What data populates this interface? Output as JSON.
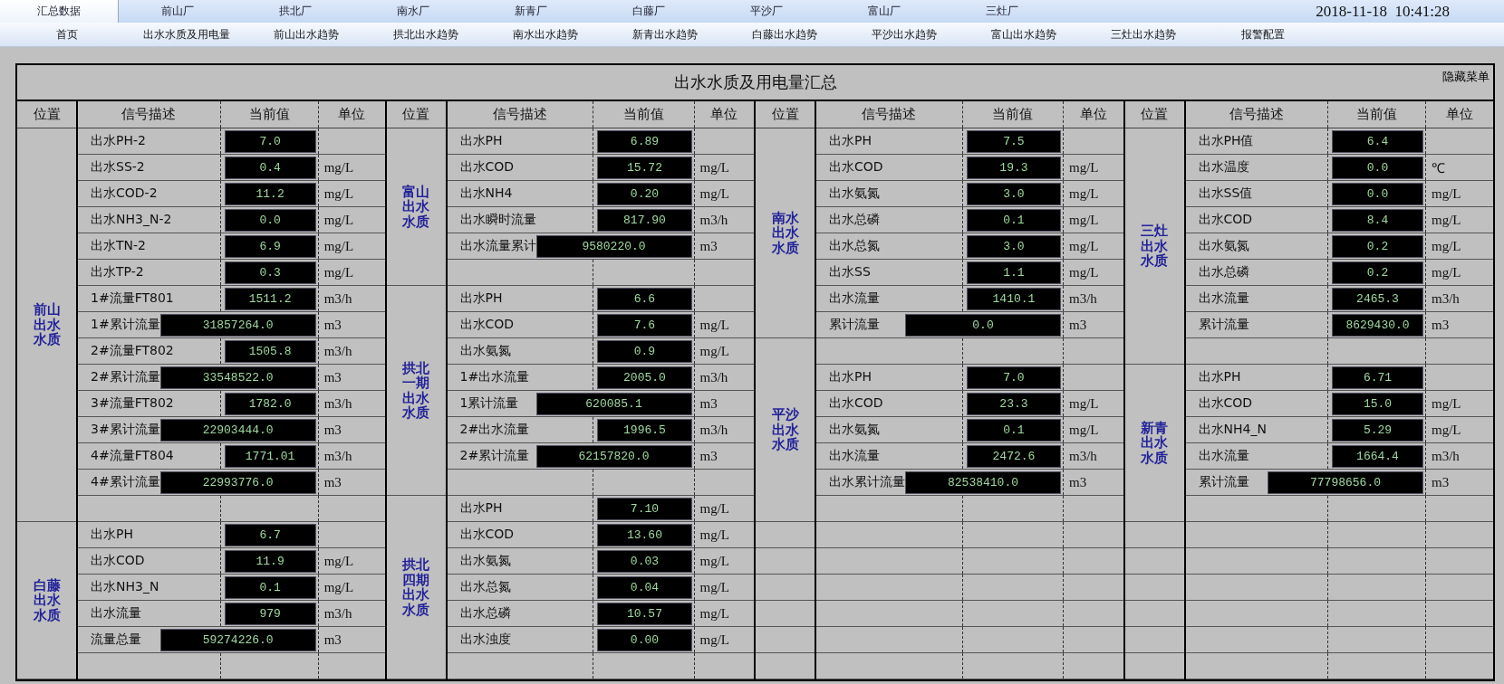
{
  "tabs": [
    {
      "label": "汇总数据",
      "selected": true
    },
    {
      "label": "前山厂",
      "selected": false
    },
    {
      "label": "拱北厂",
      "selected": false
    },
    {
      "label": "南水厂",
      "selected": false
    },
    {
      "label": "新青厂",
      "selected": false
    },
    {
      "label": "白藤厂",
      "selected": false
    },
    {
      "label": "平沙厂",
      "selected": false
    },
    {
      "label": "富山厂",
      "selected": false
    },
    {
      "label": "三灶厂",
      "selected": false
    }
  ],
  "datetime": "2018-11-18  10:41:28",
  "nav": [
    "首页",
    "出水水质及用电量",
    "前山出水趋势",
    "拱北出水趋势",
    "南水出水趋势",
    "新青出水趋势",
    "白藤出水趋势",
    "平沙出水趋势",
    "富山出水趋势",
    "三灶出水趋势",
    "报警配置"
  ],
  "panel": {
    "title": "出水水质及用电量汇总",
    "hide_menu": "隐藏菜单"
  },
  "groups": [
    {
      "headers": [
        "位置",
        "信号描述",
        "当前值",
        "单位"
      ],
      "sections": [
        {
          "location": "前山出水水质",
          "rows": [
            {
              "kind": "reading",
              "description": "出水PH-2",
              "value": "7.0"
            },
            {
              "kind": "reading",
              "description": "出水SS-2",
              "value": "0.4",
              "unit": "mg/L"
            },
            {
              "kind": "reading",
              "description": "出水COD-2",
              "value": "11.2",
              "unit": "mg/L"
            },
            {
              "kind": "reading",
              "description": "出水NH3_N-2",
              "value": "0.0",
              "unit": "mg/L"
            },
            {
              "kind": "reading",
              "description": "出水TN-2",
              "value": "6.9",
              "unit": "mg/L"
            },
            {
              "kind": "reading",
              "description": "出水TP-2",
              "value": "0.3",
              "unit": "mg/L"
            },
            {
              "kind": "reading",
              "description": "1#流量FT801",
              "value": "1511.2",
              "unit": "m3/h"
            },
            {
              "kind": "total",
              "description": "1#累计流量",
              "value": "31857264.0",
              "unit": "m3"
            },
            {
              "kind": "reading",
              "description": "2#流量FT802",
              "value": "1505.8",
              "unit": "m3/h"
            },
            {
              "kind": "total",
              "description": "2#累计流量",
              "value": "33548522.0",
              "unit": "m3"
            },
            {
              "kind": "reading",
              "description": "3#流量FT802",
              "value": "1782.0",
              "unit": "m3/h"
            },
            {
              "kind": "total",
              "description": "3#累计流量",
              "value": "22903444.0",
              "unit": "m3"
            },
            {
              "kind": "reading",
              "description": "4#流量FT804",
              "value": "1771.01",
              "unit": "m3/h"
            },
            {
              "kind": "total",
              "description": "4#累计流量",
              "value": "22993776.0",
              "unit": "m3"
            },
            {
              "kind": "blank"
            }
          ]
        },
        {
          "location": "白藤出水水质",
          "rows": [
            {
              "kind": "reading",
              "description": "出水PH",
              "value": "6.7"
            },
            {
              "kind": "reading",
              "description": "出水COD",
              "value": "11.9",
              "unit": "mg/L"
            },
            {
              "kind": "reading",
              "description": "出水NH3_N",
              "value": "0.1",
              "unit": "mg/L"
            },
            {
              "kind": "reading",
              "description": "出水流量",
              "value": "979",
              "unit": "m3/h"
            },
            {
              "kind": "total",
              "description": "流量总量",
              "value": "59274226.0",
              "unit": "m3"
            },
            {
              "kind": "blank"
            }
          ]
        }
      ]
    },
    {
      "headers": [
        "位置",
        "信号描述",
        "当前值",
        "单位"
      ],
      "sections": [
        {
          "location": "富山出水水质",
          "rows": [
            {
              "kind": "reading",
              "description": "出水PH",
              "value": "6.89"
            },
            {
              "kind": "reading",
              "description": "出水COD",
              "value": "15.72",
              "unit": "mg/L"
            },
            {
              "kind": "reading",
              "description": "出水NH4",
              "value": "0.20",
              "unit": "mg/L"
            },
            {
              "kind": "reading",
              "description": "出水瞬时流量",
              "value": "817.90",
              "unit": "m3/h"
            },
            {
              "kind": "total",
              "description": "出水流量累计",
              "value": "9580220.0",
              "unit": "m3"
            },
            {
              "kind": "blank"
            }
          ]
        },
        {
          "location": "拱北一期出水水质",
          "rows": [
            {
              "kind": "reading",
              "description": "出水PH",
              "value": "6.6"
            },
            {
              "kind": "reading",
              "description": "出水COD",
              "value": "7.6",
              "unit": "mg/L"
            },
            {
              "kind": "reading",
              "description": "出水氨氮",
              "value": "0.9",
              "unit": "mg/L"
            },
            {
              "kind": "reading",
              "description": "1#出水流量",
              "value": "2005.0",
              "unit": "m3/h"
            },
            {
              "kind": "total",
              "description": "1累计流量",
              "value": "620085.1",
              "unit": "m3"
            },
            {
              "kind": "reading",
              "description": "2#出水流量",
              "value": "1996.5",
              "unit": "m3/h"
            },
            {
              "kind": "total",
              "description": "2#累计流量",
              "value": "62157820.0",
              "unit": "m3"
            },
            {
              "kind": "blank"
            }
          ]
        },
        {
          "location": "拱北四期出水水质",
          "rows": [
            {
              "kind": "reading",
              "description": "出水PH",
              "value": "7.10",
              "unit": "mg/L"
            },
            {
              "kind": "reading",
              "description": "出水COD",
              "value": "13.60",
              "unit": "mg/L"
            },
            {
              "kind": "reading",
              "description": "出水氨氮",
              "value": "0.03",
              "unit": "mg/L"
            },
            {
              "kind": "reading",
              "description": "出水总氮",
              "value": "0.04",
              "unit": "mg/L"
            },
            {
              "kind": "reading",
              "description": "出水总磷",
              "value": "10.57",
              "unit": "mg/L"
            },
            {
              "kind": "reading",
              "description": "出水浊度",
              "value": "0.00",
              "unit": "mg/L"
            },
            {
              "kind": "blank"
            }
          ]
        }
      ]
    },
    {
      "headers": [
        "位置",
        "信号描述",
        "当前值",
        "单位"
      ],
      "sections": [
        {
          "location": "南水出水水质",
          "rows": [
            {
              "kind": "reading",
              "description": "出水PH",
              "value": "7.5"
            },
            {
              "kind": "reading",
              "description": "出水COD",
              "value": "19.3",
              "unit": "mg/L"
            },
            {
              "kind": "reading",
              "description": "出水氨氮",
              "value": "3.0",
              "unit": "mg/L"
            },
            {
              "kind": "reading",
              "description": "出水总磷",
              "value": "0.1",
              "unit": "mg/L"
            },
            {
              "kind": "reading",
              "description": "出水总氮",
              "value": "3.0",
              "unit": "mg/L"
            },
            {
              "kind": "reading",
              "description": "出水SS",
              "value": "1.1",
              "unit": "mg/L"
            },
            {
              "kind": "reading",
              "description": "出水流量",
              "value": "1410.1",
              "unit": "m3/h"
            },
            {
              "kind": "total",
              "description": "累计流量",
              "value": "0.0",
              "unit": "m3"
            }
          ]
        },
        {
          "location": "平沙出水水质",
          "rows": [
            {
              "kind": "blank"
            },
            {
              "kind": "reading",
              "description": "出水PH",
              "value": "7.0"
            },
            {
              "kind": "reading",
              "description": "出水COD",
              "value": "23.3",
              "unit": "mg/L"
            },
            {
              "kind": "reading",
              "description": "出水氨氮",
              "value": "0.1",
              "unit": "mg/L"
            },
            {
              "kind": "reading",
              "description": "出水流量",
              "value": "2472.6",
              "unit": "m3/h"
            },
            {
              "kind": "total",
              "description": "出水累计流量",
              "value": "82538410.0",
              "unit": "m3"
            },
            {
              "kind": "blank"
            }
          ]
        }
      ]
    },
    {
      "headers": [
        "位置",
        "信号描述",
        "当前值",
        "单位"
      ],
      "sections": [
        {
          "location": "三灶出水水质",
          "rows": [
            {
              "kind": "reading",
              "description": "出水PH值",
              "value": "6.4"
            },
            {
              "kind": "reading",
              "description": "出水温度",
              "value": "0.0",
              "unit": "℃"
            },
            {
              "kind": "reading",
              "description": "出水SS值",
              "value": "0.0",
              "unit": "mg/L"
            },
            {
              "kind": "reading",
              "description": "出水COD",
              "value": "8.4",
              "unit": "mg/L"
            },
            {
              "kind": "reading",
              "description": "出水氨氮",
              "value": "0.2",
              "unit": "mg/L"
            },
            {
              "kind": "reading",
              "description": "出水总磷",
              "value": "0.2",
              "unit": "mg/L"
            },
            {
              "kind": "reading",
              "description": "出水流量",
              "value": "2465.3",
              "unit": "m3/h"
            },
            {
              "kind": "reading",
              "description": "累计流量",
              "value": "8629430.0",
              "unit": "m3"
            },
            {
              "kind": "blank"
            }
          ]
        },
        {
          "location": "新青出水水质",
          "rows": [
            {
              "kind": "reading",
              "description": "出水PH",
              "value": "6.71"
            },
            {
              "kind": "reading",
              "description": "出水COD",
              "value": "15.0",
              "unit": "mg/L"
            },
            {
              "kind": "reading",
              "description": "出水NH4_N",
              "value": "5.29",
              "unit": "mg/L"
            },
            {
              "kind": "reading",
              "description": "出水流量",
              "value": "1664.4",
              "unit": "m3/h"
            },
            {
              "kind": "total",
              "description": "累计流量",
              "value": "77798656.0",
              "unit": "m3"
            },
            {
              "kind": "blank"
            }
          ]
        }
      ]
    }
  ]
}
